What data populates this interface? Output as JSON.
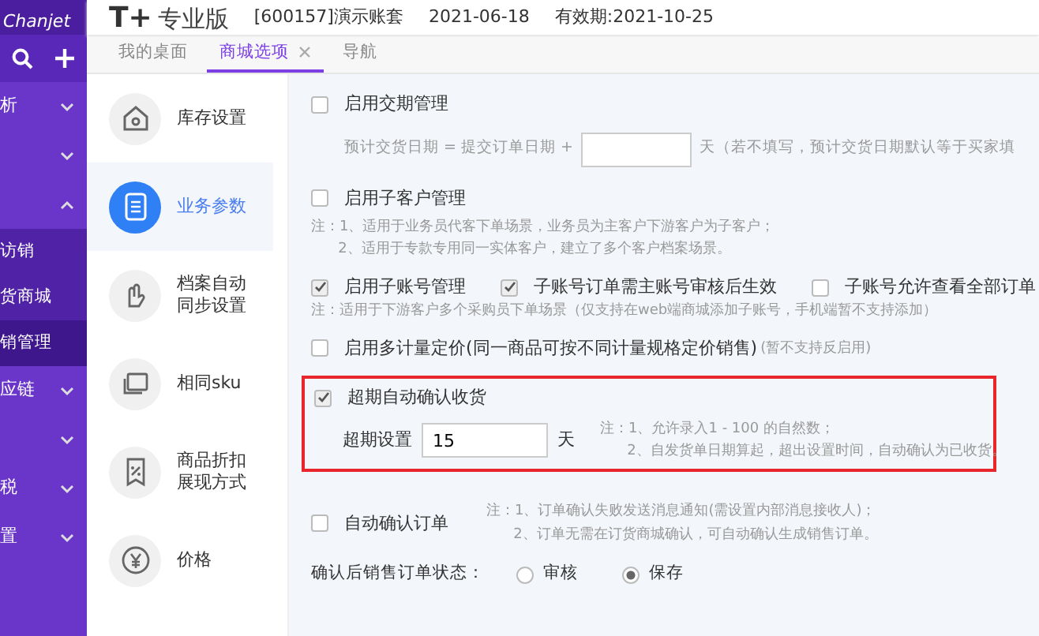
{
  "brand": {
    "logo_text": "Chanjet",
    "product": "T+",
    "edition": "专业版",
    "account": "[600157]演示账套",
    "date": "2021-06-18",
    "expiry": "有效期:2021-10-25"
  },
  "sidebar": {
    "items": [
      {
        "label": "析",
        "expanded": false
      },
      {
        "expanded": false
      },
      {
        "expanded": true,
        "children": [
          {
            "label": "访销",
            "selected": false
          },
          {
            "label": "货商城",
            "selected": false
          },
          {
            "label": "销管理",
            "selected": true
          }
        ]
      },
      {
        "label": "应链",
        "expanded": false
      },
      {
        "expanded": false
      },
      {
        "label": "税",
        "expanded": false
      },
      {
        "label": "置",
        "expanded": false
      }
    ]
  },
  "tabs": [
    {
      "label": "我的桌面",
      "selected": false
    },
    {
      "label": "商城选项",
      "selected": true
    },
    {
      "label": "导航",
      "selected": false
    }
  ],
  "options_nav": [
    {
      "label": "库存设置",
      "selected": false
    },
    {
      "label": "业务参数",
      "selected": true
    },
    {
      "label": "档案自动同步设置",
      "selected": false
    },
    {
      "label": "相同sku",
      "selected": false
    },
    {
      "label": "商品折扣展现方式",
      "selected": false
    },
    {
      "label": "价格",
      "selected": false
    }
  ],
  "settings": [
    {
      "kind": "checkbox",
      "label": "启用交期管理",
      "checked": false
    },
    {
      "kind": "formula",
      "text": "预计交货日期 = 提交订单日期 +",
      "suffix": "天（若不填写，预计交货日期默认等于买家填"
    },
    {
      "kind": "checkbox",
      "label": "启用子客户管理",
      "checked": false
    },
    {
      "kind": "note",
      "lines": [
        "注：1、适用于业务员代客下单场景，业务员为主客户下游客户为子客户；",
        "2、适用于专款专用同一实体客户，建立了多个客户档案场景。"
      ]
    },
    {
      "kind": "checkrow",
      "items": [
        {
          "label": "启用子账号管理",
          "checked": true
        },
        {
          "label": "子账号订单需主账号审核后生效",
          "checked": true
        },
        {
          "label": "子账号允许查看全部订单",
          "checked": false
        }
      ]
    },
    {
      "kind": "note",
      "lines": [
        "注：适用于下游客户多个采购员下单场景（仅支持在web端商城添加子账号，手机端暂不支持添加）"
      ]
    },
    {
      "kind": "checkbox",
      "label": "启用多计量定价(同一商品可按不同计量规格定价销售)",
      "hint": "(暂不支持反启用)",
      "checked": false
    },
    {
      "kind": "highlight",
      "label": "超期自动确认收货",
      "checked": true,
      "field_label": "超期设置",
      "value": "15",
      "unit": "天",
      "note": [
        "注：1、允许录入1 - 100 的自然数；",
        "2、自发货单日期算起，超出设置时间，自动确认为已收货。"
      ]
    },
    {
      "kind": "checknote",
      "label": "自动确认订单",
      "checked": false,
      "note": [
        "注：1、订单确认失败发送消息通知(需设置内部消息接收人)；",
        "2、订单无需在订货商城确认，可自动确认生成销售订单。"
      ]
    },
    {
      "kind": "radios",
      "label": "确认后销售订单状态：",
      "options": [
        {
          "label": "审核",
          "selected": false
        },
        {
          "label": "保存",
          "selected": true
        }
      ]
    }
  ]
}
